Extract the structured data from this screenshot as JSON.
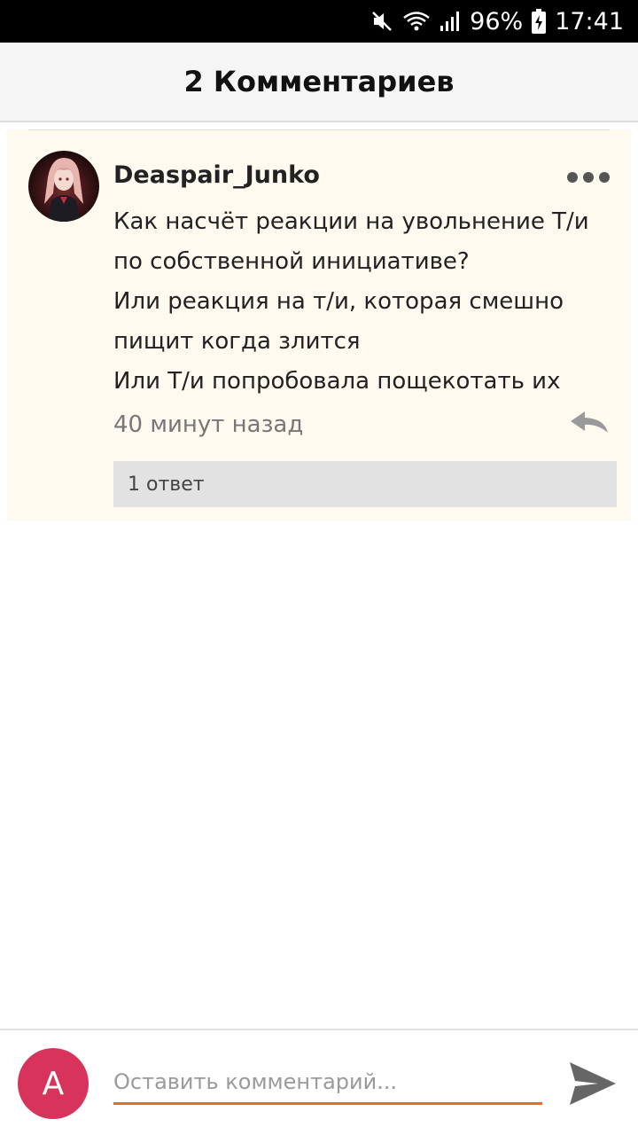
{
  "status_bar": {
    "battery": "96%",
    "time": "17:41",
    "icons": [
      "mute-icon",
      "wifi-icon",
      "signal-icon",
      "battery-charging-icon"
    ]
  },
  "header": {
    "title": "2 Комментариев"
  },
  "comment": {
    "username": "Deaspair_Junko",
    "lines": [
      "Как насчёт реакции на увольнение Т/и",
      "по собственной инициативе?",
      "Или реакция на т/и, которая смешно",
      "пищит когда злится",
      "Или Т/и попробовала пощекотать их"
    ],
    "timestamp": "40 минут назад",
    "replies_label": "1 ответ"
  },
  "compose": {
    "avatar_letter": "A",
    "placeholder": "Оставить комментарий..."
  },
  "colors": {
    "accent": "#f26522",
    "avatar_bg": "#d8335b",
    "comment_bg": "#fffaf0"
  }
}
